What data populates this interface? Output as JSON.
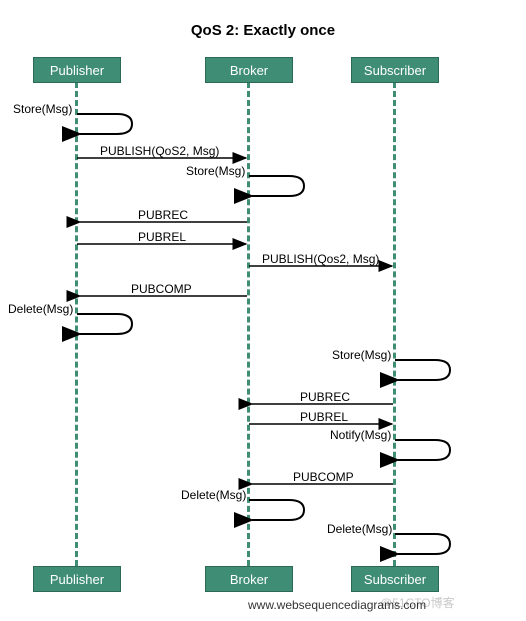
{
  "title": "QoS 2: Exactly once",
  "participants": {
    "publisher": "Publisher",
    "broker": "Broker",
    "subscriber": "Subscriber"
  },
  "messages": {
    "store_p": "Store(Msg)",
    "publish_pb": "PUBLISH(QoS2, Msg)",
    "store_b": "Store(Msg)",
    "pubrec_bp": "PUBREC",
    "pubrel_pb": "PUBREL",
    "publish_bs": "PUBLISH(Qos2, Msg)",
    "pubcomp_bp": "PUBCOMP",
    "delete_p": "Delete(Msg)",
    "store_s": "Store(Msg)",
    "pubrec_sb": "PUBREC",
    "pubrel_bs": "PUBREL",
    "notify_s": "Notify(Msg)",
    "pubcomp_sb": "PUBCOMP",
    "delete_b": "Delete(Msg)",
    "delete_s": "Delete(Msg)"
  },
  "footer": "www.websequencediagrams.com",
  "watermark": "@51CTO博客",
  "chart_data": {
    "type": "sequence-diagram",
    "title": "QoS 2: Exactly once",
    "participants": [
      "Publisher",
      "Broker",
      "Subscriber"
    ],
    "events": [
      {
        "type": "self",
        "actor": "Publisher",
        "label": "Store(Msg)"
      },
      {
        "type": "message",
        "from": "Publisher",
        "to": "Broker",
        "label": "PUBLISH(QoS2, Msg)"
      },
      {
        "type": "self",
        "actor": "Broker",
        "label": "Store(Msg)"
      },
      {
        "type": "message",
        "from": "Broker",
        "to": "Publisher",
        "label": "PUBREC"
      },
      {
        "type": "message",
        "from": "Publisher",
        "to": "Broker",
        "label": "PUBREL"
      },
      {
        "type": "message",
        "from": "Broker",
        "to": "Subscriber",
        "label": "PUBLISH(Qos2, Msg)"
      },
      {
        "type": "message",
        "from": "Broker",
        "to": "Publisher",
        "label": "PUBCOMP"
      },
      {
        "type": "self",
        "actor": "Publisher",
        "label": "Delete(Msg)"
      },
      {
        "type": "self",
        "actor": "Subscriber",
        "label": "Store(Msg)"
      },
      {
        "type": "message",
        "from": "Subscriber",
        "to": "Broker",
        "label": "PUBREC"
      },
      {
        "type": "message",
        "from": "Broker",
        "to": "Subscriber",
        "label": "PUBREL"
      },
      {
        "type": "self",
        "actor": "Subscriber",
        "label": "Notify(Msg)"
      },
      {
        "type": "message",
        "from": "Subscriber",
        "to": "Broker",
        "label": "PUBCOMP"
      },
      {
        "type": "self",
        "actor": "Broker",
        "label": "Delete(Msg)"
      },
      {
        "type": "self",
        "actor": "Subscriber",
        "label": "Delete(Msg)"
      }
    ]
  }
}
